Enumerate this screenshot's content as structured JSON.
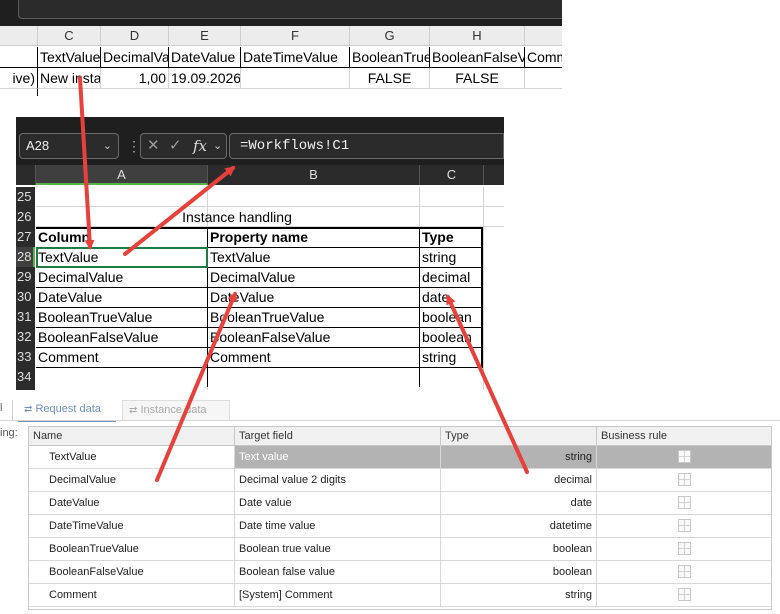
{
  "top_sheet": {
    "columns": [
      "C",
      "D",
      "E",
      "F",
      "G",
      "H"
    ],
    "header_row": [
      "TextValue",
      "DecimalValue",
      "DateValue",
      "DateTimeValue",
      "BooleanTrueValue",
      "BooleanFalseValue",
      "Comm"
    ],
    "row1": {
      "prefix": "ive)",
      "text": "New insta",
      "decimal": "1,00",
      "date": "19.09.2026",
      "bool_true": "FALSE",
      "bool_false": "FALSE"
    },
    "row2_prefix": " )"
  },
  "excel": {
    "name_box": "A28",
    "formula": "=Workflows!C1",
    "columns": [
      "A",
      "B",
      "C"
    ],
    "row_numbers": [
      "25",
      "26",
      "27",
      "28",
      "29",
      "30",
      "31",
      "32",
      "33",
      "34"
    ],
    "section_title": "Instance handling",
    "header": {
      "col_a": "Column",
      "col_b": "Property name",
      "col_c": "Type"
    },
    "rows": [
      {
        "a": "TextValue",
        "b": "TextValue",
        "c": "string"
      },
      {
        "a": "DecimalValue",
        "b": "DecimalValue",
        "c": "decimal"
      },
      {
        "a": "DateValue",
        "b": "DateValue",
        "c": "date"
      },
      {
        "a": "BooleanTrueValue",
        "b": "BooleanTrueValue",
        "c": "boolean"
      },
      {
        "a": "BooleanFalseValue",
        "b": "BooleanFalseValue",
        "c": "boolean"
      },
      {
        "a": "Comment",
        "b": "Comment",
        "c": "string"
      }
    ]
  },
  "mapping": {
    "side_label": "ing:",
    "tabs": {
      "request": "Request data",
      "instance": "Instance data",
      "left_stub": "l"
    },
    "headers": {
      "name": "Name",
      "target": "Target field",
      "type": "Type",
      "rule": "Business rule"
    },
    "rows": [
      {
        "name": "TextValue",
        "target": "Text value",
        "type": "string",
        "selected": true
      },
      {
        "name": "DecimalValue",
        "target": "Decimal value 2 digits",
        "type": "decimal"
      },
      {
        "name": "DateValue",
        "target": "Date value",
        "type": "date"
      },
      {
        "name": "DateTimeValue",
        "target": "Date time value",
        "type": "datetime"
      },
      {
        "name": "BooleanTrueValue",
        "target": "Boolean true value",
        "type": "boolean"
      },
      {
        "name": "BooleanFalseValue",
        "target": "Boolean false value",
        "type": "boolean"
      },
      {
        "name": "Comment",
        "target": "[System] Comment",
        "type": "string"
      }
    ]
  },
  "colors": {
    "arrow": "#e8403b",
    "selected_row": "#b3b3b3",
    "excel_dark": "#1f1f1f"
  }
}
